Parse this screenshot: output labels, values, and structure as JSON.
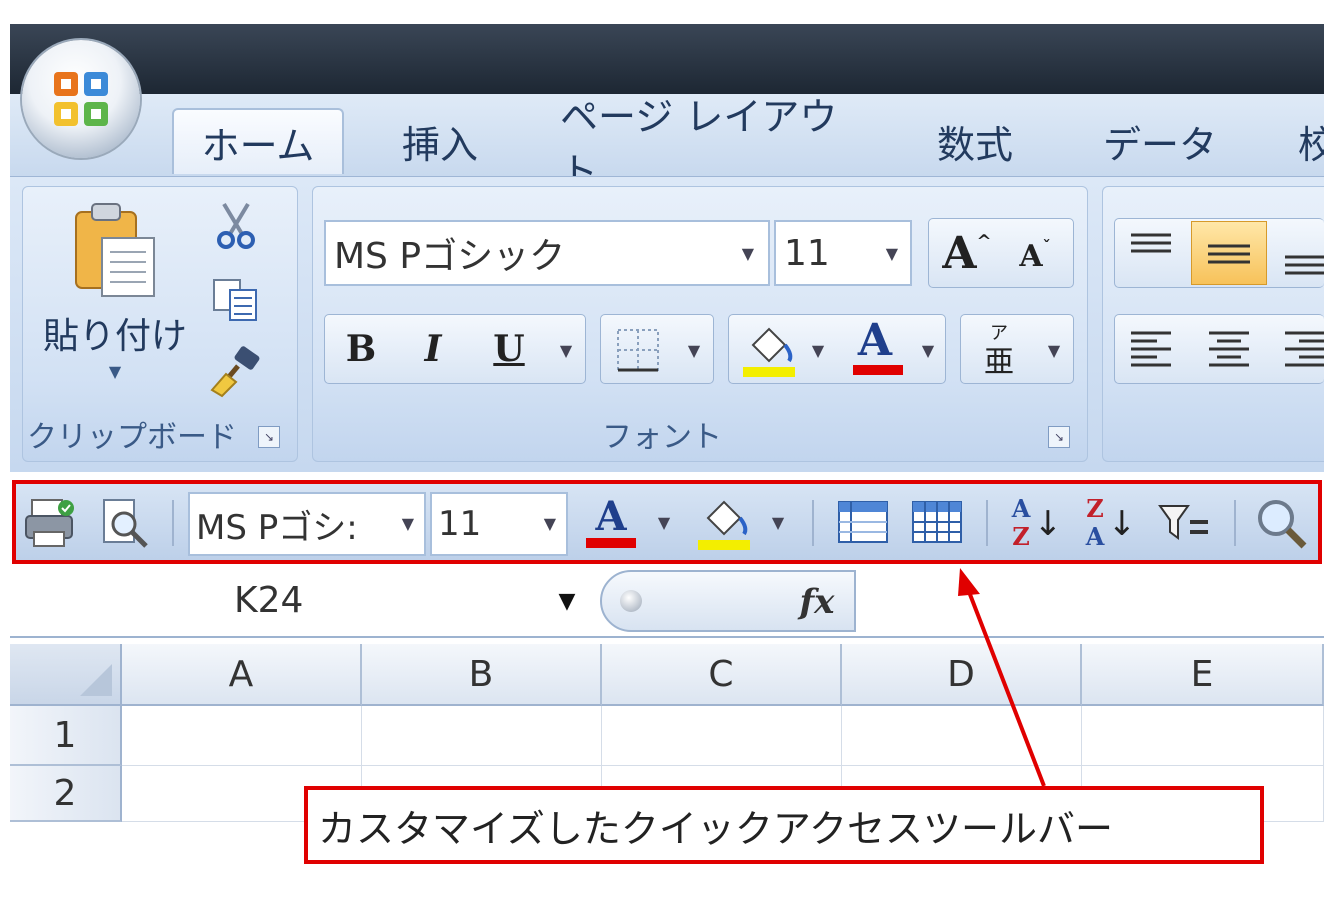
{
  "tabs": [
    "ホーム",
    "挿入",
    "ページ レイアウト",
    "数式",
    "データ",
    "校"
  ],
  "ribbon": {
    "clipboard": {
      "paste_label": "貼り付け",
      "group_label": "クリップボード"
    },
    "font": {
      "font_name": "MS Pゴシック",
      "font_size": "11",
      "bold": "B",
      "italic": "I",
      "underline": "U",
      "grow": "A",
      "shrink": "A",
      "font_color": "A",
      "phonetic_top": "ア",
      "phonetic_bottom": "亜",
      "group_label": "フォント"
    }
  },
  "qat": {
    "font_name": "MS Pゴシ:",
    "font_size": "11",
    "font_color": "A",
    "sort_asc_top": "A",
    "sort_asc_bottom": "Z",
    "sort_desc_top": "Z",
    "sort_desc_bottom": "A"
  },
  "formula_bar": {
    "name_box": "K24",
    "fx_label": "fx"
  },
  "sheet": {
    "columns": [
      "A",
      "B",
      "C",
      "D",
      "E"
    ],
    "rows": [
      "1",
      "2"
    ]
  },
  "annotation": {
    "text": "カスタマイズしたクイックアクセスツールバー"
  },
  "colors": {
    "highlight_red": "#e00000",
    "fill_yellow": "#f3ee00",
    "font_red": "#e00000"
  }
}
